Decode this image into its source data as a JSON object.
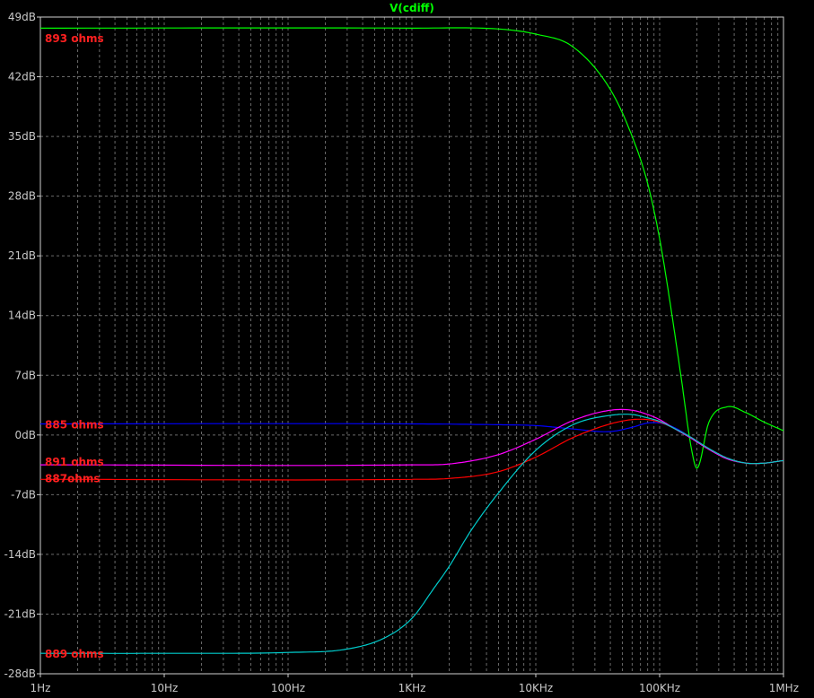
{
  "chart_data": {
    "type": "line",
    "title": "V(cdiff)",
    "x_scale": "log",
    "xlim": [
      1,
      1000000
    ],
    "ylim": [
      -28,
      49
    ],
    "x_ticks": [
      {
        "value": 1,
        "label": "1Hz"
      },
      {
        "value": 10,
        "label": "10Hz"
      },
      {
        "value": 100,
        "label": "100Hz"
      },
      {
        "value": 1000,
        "label": "1KHz"
      },
      {
        "value": 10000,
        "label": "10KHz"
      },
      {
        "value": 100000,
        "label": "100KHz"
      },
      {
        "value": 1000000,
        "label": "1MHz"
      }
    ],
    "y_ticks": [
      {
        "value": 49,
        "label": "49dB"
      },
      {
        "value": 42,
        "label": "42dB"
      },
      {
        "value": 35,
        "label": "35dB"
      },
      {
        "value": 28,
        "label": "28dB"
      },
      {
        "value": 21,
        "label": "21dB"
      },
      {
        "value": 14,
        "label": "14dB"
      },
      {
        "value": 7,
        "label": "7dB"
      },
      {
        "value": 0,
        "label": "0dB"
      },
      {
        "value": -7,
        "label": "-7dB"
      },
      {
        "value": -14,
        "label": "-14dB"
      },
      {
        "value": -21,
        "label": "-21dB"
      },
      {
        "value": -28,
        "label": "-28dB"
      }
    ],
    "grid": true,
    "series": [
      {
        "color": "#00ff00",
        "x": [
          1,
          1000,
          5000,
          10000,
          20000,
          40000,
          60000,
          80000,
          100000,
          120000,
          150000,
          180000,
          200000,
          250000,
          350000,
          500000,
          700000,
          1000000
        ],
        "y": [
          47.7,
          47.7,
          47.6,
          47.0,
          45.5,
          40.5,
          35.0,
          29.5,
          23.0,
          16.0,
          6.5,
          -1.5,
          -3.9,
          1.5,
          3.3,
          2.6,
          1.5,
          0.5
        ]
      },
      {
        "color": "#0000ff",
        "x": [
          1,
          1000,
          5000,
          10000,
          20000,
          40000,
          60000,
          80000,
          100000,
          130000,
          180000,
          250000,
          350000,
          500000,
          700000,
          1000000
        ],
        "y": [
          1.3,
          1.3,
          1.2,
          1.1,
          0.7,
          0.4,
          0.9,
          1.4,
          1.4,
          0.9,
          -0.3,
          -1.6,
          -2.7,
          -3.3,
          -3.3,
          -3.0
        ]
      },
      {
        "color": "#ff00ff",
        "x": [
          1,
          1000,
          2000,
          5000,
          10000,
          20000,
          40000,
          60000,
          80000,
          100000,
          130000,
          180000,
          250000,
          350000,
          500000,
          700000,
          1000000
        ],
        "y": [
          -3.5,
          -3.5,
          -3.4,
          -2.3,
          -0.5,
          1.7,
          2.9,
          2.9,
          2.4,
          1.8,
          0.8,
          -0.4,
          -1.7,
          -2.8,
          -3.3,
          -3.3,
          -3.0
        ]
      },
      {
        "color": "#ff0000",
        "x": [
          1,
          1000,
          2000,
          5000,
          10000,
          20000,
          40000,
          60000,
          80000,
          100000,
          130000,
          180000,
          250000,
          350000,
          500000,
          700000,
          1000000
        ],
        "y": [
          -5.2,
          -5.2,
          -5.1,
          -4.3,
          -2.6,
          -0.3,
          1.3,
          1.8,
          1.8,
          1.5,
          0.8,
          -0.3,
          -1.6,
          -2.7,
          -3.3,
          -3.3,
          -3.0
        ]
      },
      {
        "color": "#00cccc",
        "x": [
          1,
          10,
          100,
          300,
          600,
          1000,
          1500,
          2000,
          3000,
          5000,
          10000,
          20000,
          40000,
          60000,
          80000,
          100000,
          130000,
          180000,
          250000,
          350000,
          500000,
          700000,
          1000000
        ],
        "y": [
          -25.6,
          -25.6,
          -25.5,
          -25.1,
          -23.8,
          -21.5,
          -18.0,
          -15.4,
          -11.2,
          -6.8,
          -1.8,
          1.2,
          2.3,
          2.4,
          2.0,
          1.6,
          0.8,
          -0.3,
          -1.6,
          -2.7,
          -3.3,
          -3.3,
          -3.0
        ]
      }
    ],
    "annotations": [
      {
        "text": "893 ohms",
        "y": 46.5,
        "color": "#ff2020"
      },
      {
        "text": "885 ohms",
        "y": 1.2,
        "color": "#ff2020"
      },
      {
        "text": "891 ohms",
        "y": -3.2,
        "color": "#ff2020"
      },
      {
        "text": "887ohms",
        "y": -5.1,
        "color": "#ff2020"
      },
      {
        "text": "889 ohms",
        "y": -25.7,
        "color": "#ff2020"
      }
    ]
  }
}
